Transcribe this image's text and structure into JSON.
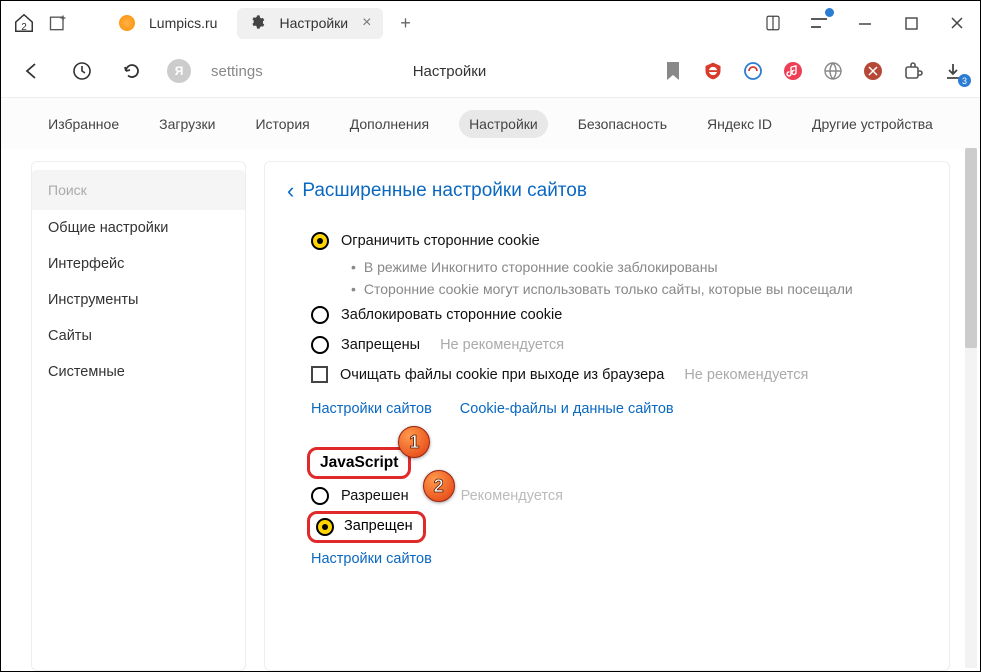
{
  "window": {
    "home_badge": "2",
    "tabs": [
      {
        "label": "Lumpics.ru"
      },
      {
        "label": "Настройки"
      }
    ],
    "new_tab_plus": "+",
    "close": "×"
  },
  "navbar": {
    "url_letter": "Я",
    "url_text": "settings",
    "page_title": "Настройки",
    "download_count": "3"
  },
  "subnav": {
    "items": [
      "Избранное",
      "Загрузки",
      "История",
      "Дополнения",
      "Настройки",
      "Безопасность",
      "Яндекс ID",
      "Другие устройства"
    ],
    "active_index": 4
  },
  "sidebar": {
    "search_placeholder": "Поиск",
    "items": [
      "Общие настройки",
      "Интерфейс",
      "Инструменты",
      "Сайты",
      "Системные"
    ]
  },
  "main": {
    "back_chevron": "‹",
    "heading": "Расширенные настройки сайтов",
    "cookie": {
      "opt_limit": "Ограничить сторонние cookie",
      "bullets": [
        "В режиме Инкогнито сторонние cookie заблокированы",
        "Сторонние cookie могут использовать только сайты, которые вы посещали"
      ],
      "opt_block": "Заблокировать сторонние cookie",
      "opt_deny": "Запрещены",
      "opt_deny_hint": "Не рекомендуется",
      "opt_clear": "Очищать файлы cookie при выходе из браузера",
      "opt_clear_hint": "Не рекомендуется",
      "link_sites": "Настройки сайтов",
      "link_cookies": "Cookie-файлы и данные сайтов"
    },
    "js": {
      "heading": "JavaScript",
      "opt_allow": "Разрешен",
      "opt_allow_hint": "Рекомендуется",
      "opt_deny": "Запрещен",
      "link_sites": "Настройки сайтов"
    }
  },
  "annotations": {
    "n1": "1",
    "n2": "2"
  }
}
